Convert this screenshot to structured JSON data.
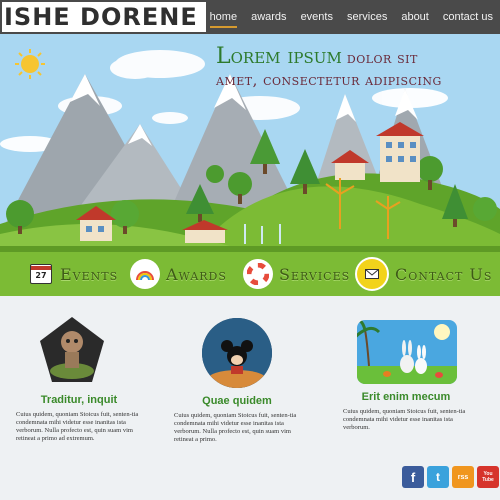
{
  "header": {
    "logo": "ISHE DORENE",
    "nav": [
      "home",
      "awards",
      "events",
      "services",
      "about",
      "contact us"
    ],
    "active_nav": "home"
  },
  "hero": {
    "title_big": "Lorem ipsum",
    "title_rest_1": "dolor sit",
    "title_rest_2": "amet, consectetur adipiscing"
  },
  "features": {
    "events": {
      "label": "Events",
      "icon": "calendar-icon",
      "date": "27"
    },
    "awards": {
      "label": "Awards",
      "icon": "rainbow-icon"
    },
    "services": {
      "label": "Services",
      "icon": "lifebuoy-icon"
    },
    "contact": {
      "label": "Contact Us",
      "icon": "mail-icon"
    }
  },
  "cards": [
    {
      "title": "Traditur, inquit",
      "text": "Cuius quidem, quoniam Stoicus fuit, senten-tia condemnata mihi videtur esse inanitas ista verborum. Nulla profecto est, quin suam vim retineat a primo ad extremum."
    },
    {
      "title": "Quae quidem",
      "text": "Cuius quidem, quoniam Stoicus fuit, senten-tia condemnata mihi videtur esse inanitas ista verborum. Nulla profecto est, quin suam vim retineat a primo."
    },
    {
      "title": "Erit enim mecum",
      "text": "Cuius quidem, quoniam Stoicus fuit, senten-tia condemnata mihi videtur esse inanitas ista verborum."
    }
  ],
  "social": {
    "facebook": "f",
    "twitter": "t",
    "rss": "rss",
    "youtube": "You Tube"
  },
  "colors": {
    "green": "#7cbb35",
    "dark_bar": "#4a4a4a",
    "accent": "#d59a2f"
  }
}
